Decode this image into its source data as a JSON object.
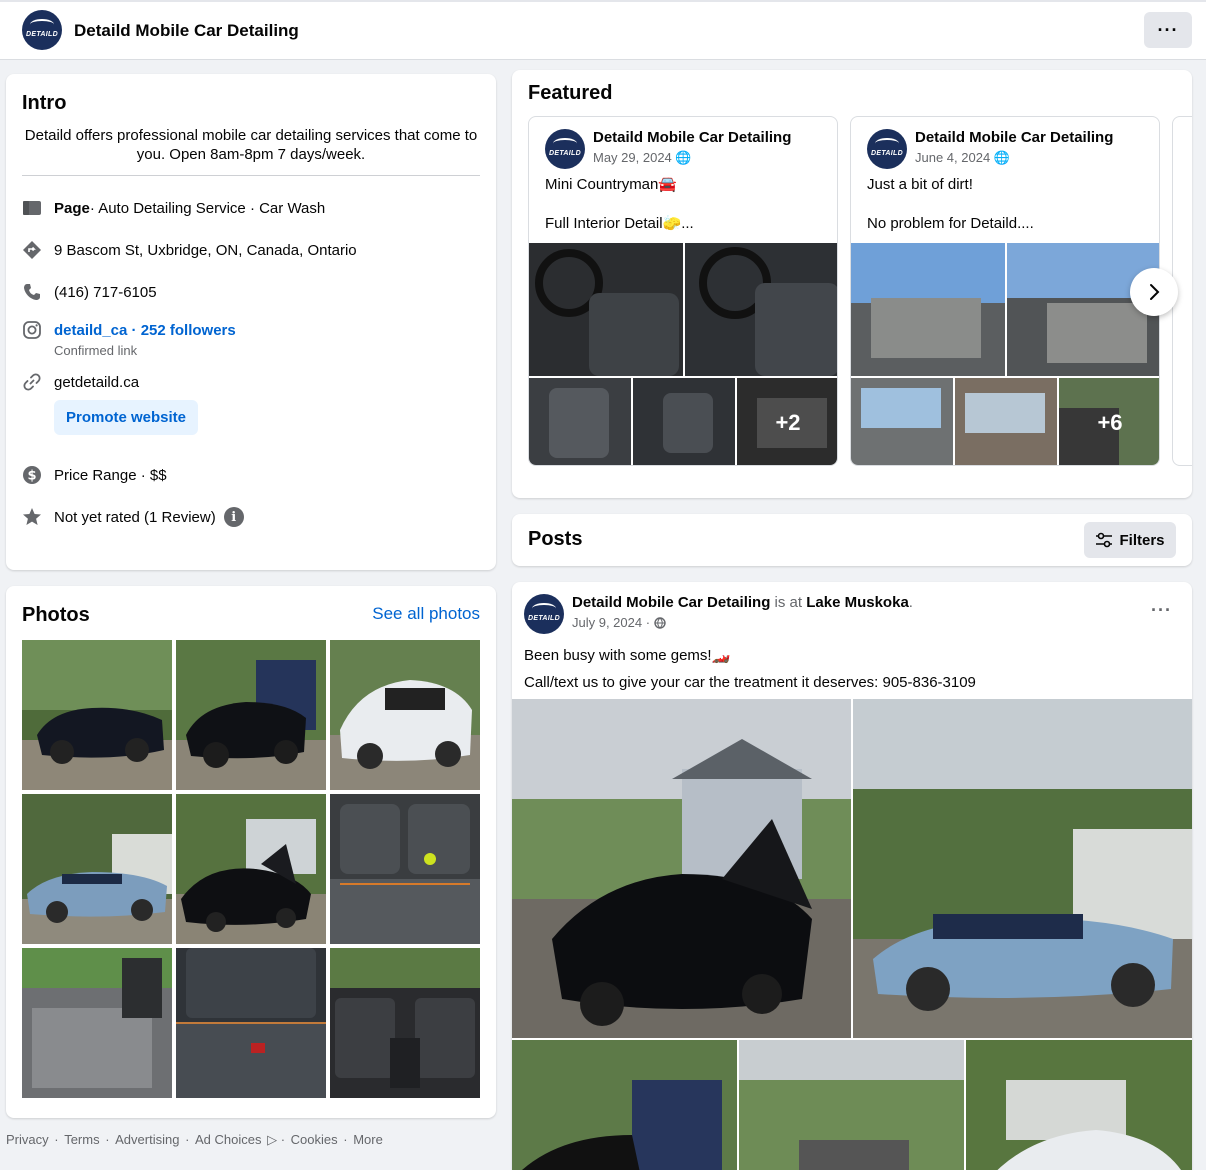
{
  "header": {
    "page_name": "Detaild Mobile Car Detailing",
    "logo_text": "DETAILD",
    "more_icon": "···"
  },
  "intro": {
    "title": "Intro",
    "description": "Detaild offers professional mobile car detailing services that come to you. Open 8am-8pm 7 days/week.",
    "page_label": "Page",
    "category": " · Auto Detailing Service · Car Wash",
    "address": "9 Bascom St, Uxbridge, ON, Canada, Ontario",
    "phone": "(416) 717-6105",
    "instagram": "detaild_ca · 252 followers",
    "instagram_sub": "Confirmed link",
    "website": "getdetaild.ca",
    "promote_label": "Promote website",
    "price_range": "Price Range · $$",
    "rating": "Not yet rated (1 Review)",
    "info_glyph": "i"
  },
  "photos": {
    "title": "Photos",
    "see_all": "See all photos"
  },
  "footer": {
    "links": [
      "Privacy",
      " · ",
      "Terms",
      " · ",
      "Advertising",
      " · ",
      "Ad Choices",
      " ▷ · ",
      "Cookies",
      " · ",
      "More"
    ]
  },
  "featured": {
    "title": "Featured",
    "cards": [
      {
        "name": "Detaild Mobile Car Detailing",
        "date": "May 29, 2024",
        "line1": "Mini Countryman🚘",
        "line2": "Full Interior Detail🧽...",
        "more_count": "+2"
      },
      {
        "name": "Detaild Mobile Car Detailing",
        "date": "June 4, 2024",
        "line1": "Just a bit of dirt!",
        "line2": "No problem for Detaild....",
        "more_count": "+6"
      }
    ]
  },
  "posts": {
    "title": "Posts",
    "filters_label": "Filters",
    "post": {
      "author": "Detaild Mobile Car Detailing",
      "is_at": " is at ",
      "location": "Lake Muskoka",
      "period": ".",
      "date": "July 9, 2024",
      "date_sep": " · ",
      "line1": "Been busy with some gems!🏎️",
      "line2": "Call/text us to give your car the treatment it deserves: 905-836-3109",
      "more_icon": "···"
    }
  },
  "colors": {
    "link": "#0064d1",
    "brand_navy": "#1b2f5c",
    "background": "#f0f2f5"
  }
}
